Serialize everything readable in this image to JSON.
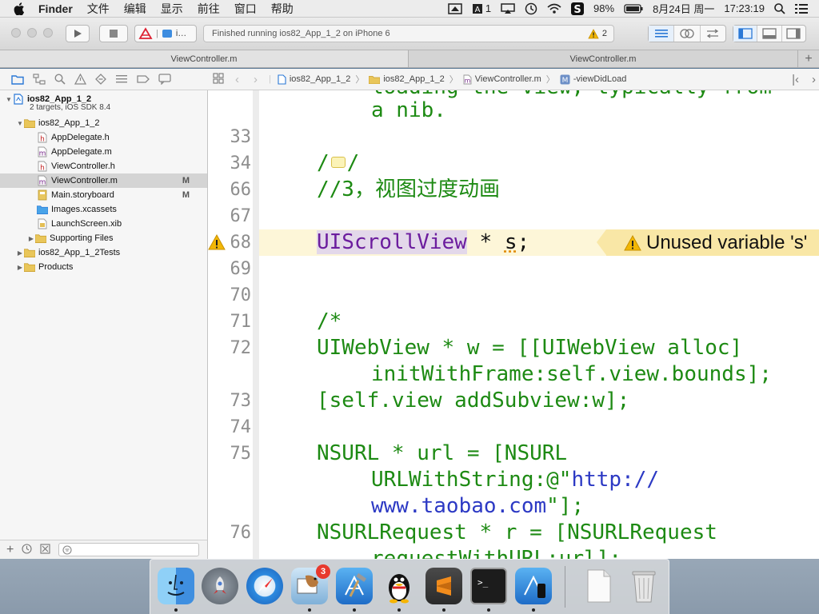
{
  "menubar": {
    "app": "Finder",
    "items": [
      "文件",
      "编辑",
      "显示",
      "前往",
      "窗口",
      "帮助"
    ],
    "status_text_1": "1",
    "battery": "98%",
    "date": "8月24日 周一",
    "time": "17:23:19"
  },
  "toolbar": {
    "scheme_text": "i…",
    "activity_text": "Finished running ios82_App_1_2 on iPhone 6",
    "warning_count": "2"
  },
  "tabs": [
    "ViewController.m",
    "ViewController.m"
  ],
  "navigator": {
    "project_name": "ios82_App_1_2",
    "project_sub": "2 targets, iOS SDK 8.4",
    "items": [
      {
        "label": "ios82_App_1_2",
        "icon": "folder-icon"
      },
      {
        "label": "AppDelegate.h",
        "icon": "header-file-icon"
      },
      {
        "label": "AppDelegate.m",
        "icon": "impl-file-icon"
      },
      {
        "label": "ViewController.h",
        "icon": "header-file-icon"
      },
      {
        "label": "ViewController.m",
        "icon": "impl-file-icon",
        "flag": "M"
      },
      {
        "label": "Main.storyboard",
        "icon": "storyboard-icon",
        "flag": "M"
      },
      {
        "label": "Images.xcassets",
        "icon": "asset-folder-icon"
      },
      {
        "label": "LaunchScreen.xib",
        "icon": "xib-icon"
      },
      {
        "label": "Supporting Files",
        "icon": "folder-icon"
      },
      {
        "label": "ios82_App_1_2Tests",
        "icon": "folder-icon"
      },
      {
        "label": "Products",
        "icon": "folder-icon"
      }
    ]
  },
  "jumpbar": {
    "crumbs": [
      "ios82_App_1_2",
      "ios82_App_1_2",
      "ViewController.m",
      "-viewDidLoad"
    ]
  },
  "editor": {
    "line_numbers": [
      "33",
      "34",
      "66",
      "67",
      "68",
      "69",
      "70",
      "71",
      "72",
      "73",
      "74",
      "75",
      "76"
    ],
    "code": {
      "l0a": "loading the view, typically from",
      "l0b": "a nib.",
      "l34a": "/",
      "l34b": "/",
      "l66": "//3，视图过度动画",
      "l68a": "UIScrollView",
      "l68b": " * ",
      "l68c": "s",
      "l68d": ";",
      "l71": "/*",
      "l72a": "UIWebView * w = [[UIWebView alloc]",
      "l72b": "initWithFrame:self.view.bounds];",
      "l73": "[self.view addSubview:w];",
      "l75a": "NSURL * url = [NSURL",
      "l75b": "URLWithString:@\"",
      "l75c": "http://",
      "l75d": "www.taobao.com",
      "l75e": "\"];",
      "l76a": "NSURLRequest * r = [NSURLRequest",
      "l76b": "requestWithURL:url];"
    },
    "warning_message": "Unused variable 's'"
  },
  "dock": {
    "apps": [
      "Finder",
      "Launchpad",
      "Safari",
      "Mail Bird",
      "Xcode",
      "QQ",
      "Sublime Text",
      "Terminal",
      "iOS Simulator",
      "Document",
      "Trash"
    ],
    "mail_badge": "3"
  },
  "colors": {
    "code_green": "#1d8a13",
    "type_purple": "#6c1d9e",
    "string_red": "#c41a16",
    "url_blue": "#2c39c4",
    "warning_yellow": "#f9e7a6"
  }
}
